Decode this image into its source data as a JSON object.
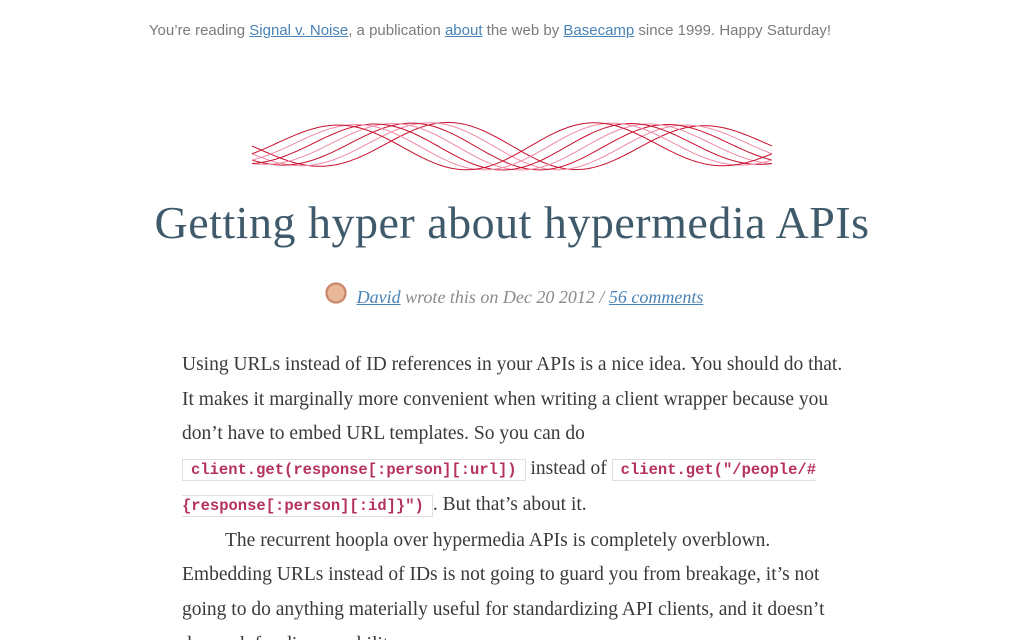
{
  "masthead": {
    "prefix": "You’re reading ",
    "publication_link": "Signal v. Noise",
    "middle": ", a publication ",
    "about_link": "about",
    "web_by": " the web by ",
    "basecamp_link": "Basecamp",
    "suffix": " since 1999. Happy Saturday!"
  },
  "colors": {
    "accent_red": "#c8102e",
    "ornament_pink": "#f08aa6",
    "title_color": "#3f5a6b",
    "link_blue": "#4a83b6",
    "code_text": "#b5325e"
  },
  "article": {
    "title": "Getting hyper about hypermedia APIs",
    "byline": {
      "author": "David",
      "middle": " wrote this on Dec 20 2012 / ",
      "comments_link": "56 comments"
    },
    "para1": {
      "text_before": "Using URLs instead of ID references in your APIs is a nice idea. You should do that. It makes it marginally more convenient when writing a client wrapper because you don’t have to embed URL templates. So you can do ",
      "code1": "client.get(response[:person][:url])",
      "text_mid": " instead of ",
      "code2": "client.get(\"/people/#{response[:person][:id]}\")",
      "text_after": ". But that’s about it."
    },
    "para2": {
      "text": "The recurrent hoopla over hypermedia APIs is completely overblown. Embedding URLs instead of IDs is not going to guard you from breakage, it’s not going to do anything materially useful for standardizing API clients, and it doesn’t do much for discoverability."
    }
  }
}
